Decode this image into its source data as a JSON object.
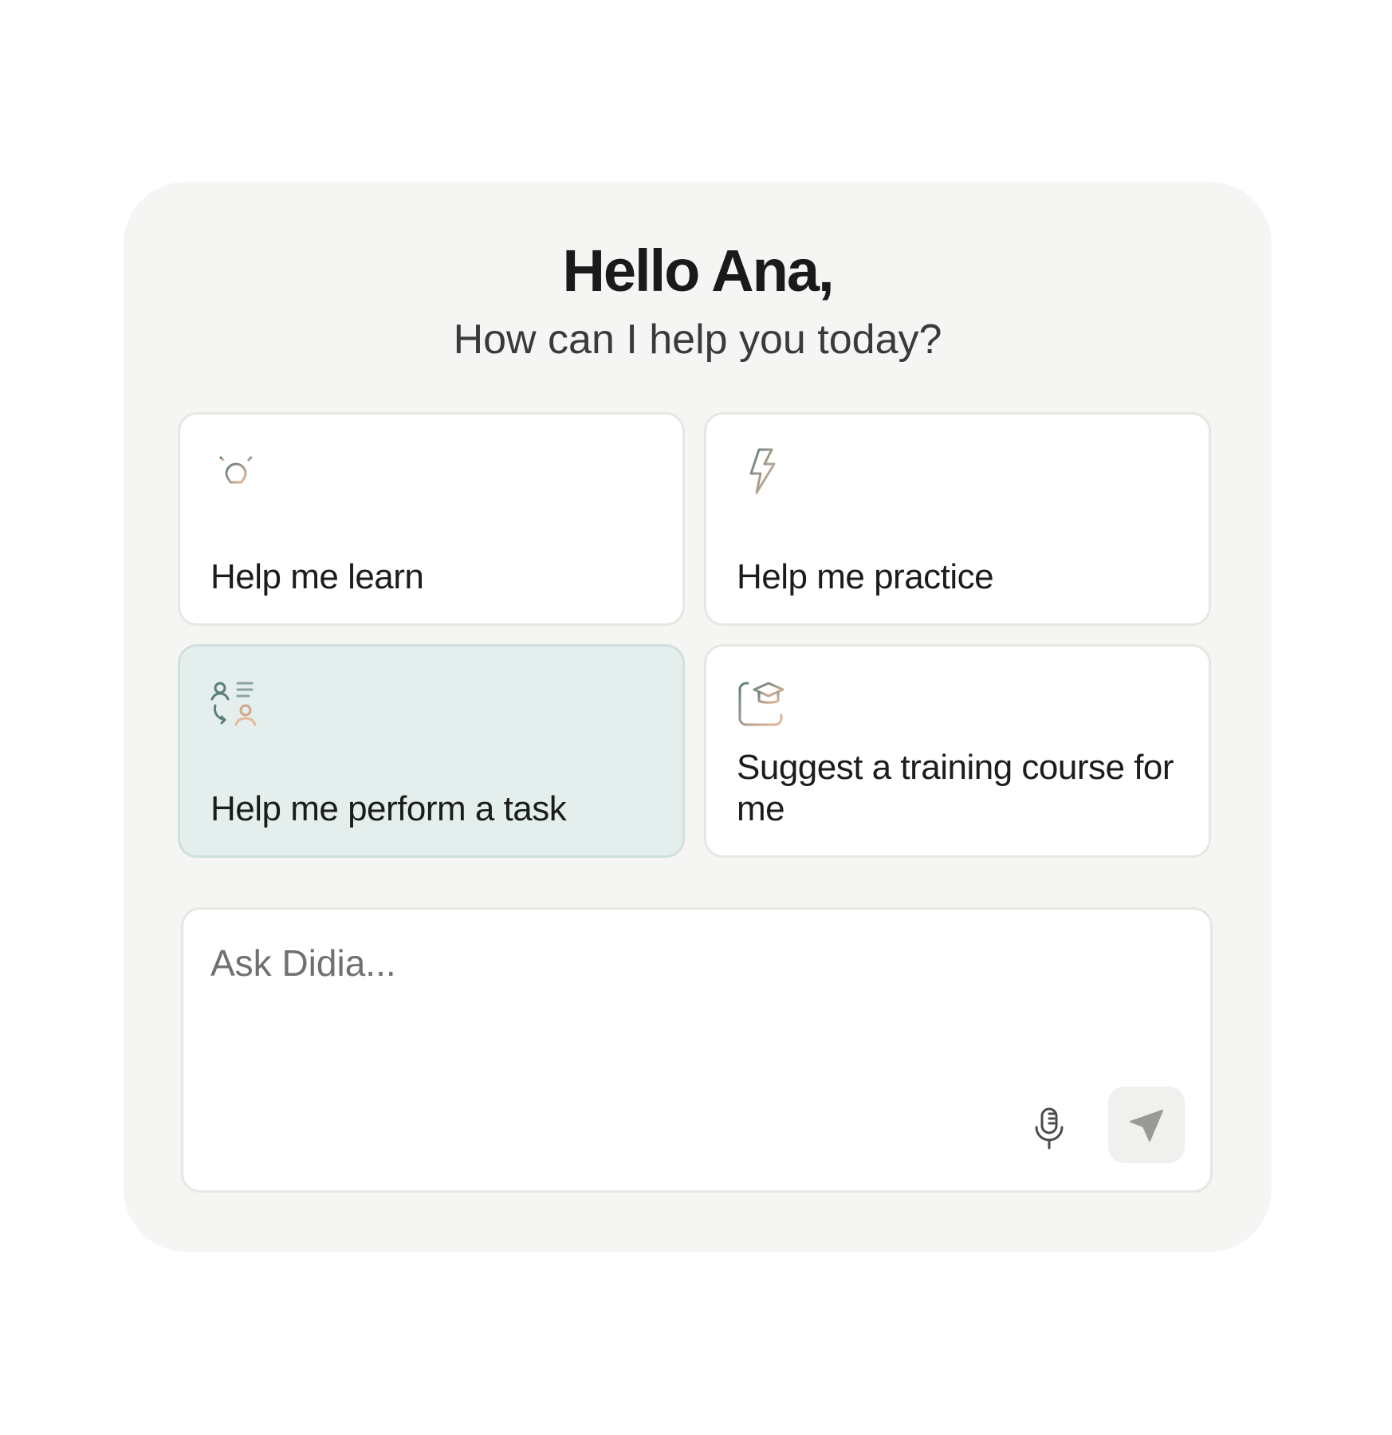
{
  "header": {
    "greeting": "Hello Ana,",
    "subtitle": "How can I help you today?"
  },
  "cards": [
    {
      "label": "Help me learn",
      "icon": "lightbulb-icon",
      "active": false
    },
    {
      "label": "Help me practice",
      "icon": "lightning-icon",
      "active": false
    },
    {
      "label": "Help me perform a task",
      "icon": "task-people-icon",
      "active": true
    },
    {
      "label": "Suggest a training course for me",
      "icon": "graduation-cap-icon",
      "active": false
    }
  ],
  "input": {
    "placeholder": "Ask Didia...",
    "value": ""
  },
  "actions": {
    "mic_icon": "microphone-icon",
    "send_icon": "send-icon"
  },
  "colors": {
    "panel_bg": "#f5f5f4",
    "card_bg": "#ffffff",
    "card_active_bg": "#e3eeed",
    "icon_teal": "#5c7f7e",
    "icon_peach": "#e8b89a"
  }
}
